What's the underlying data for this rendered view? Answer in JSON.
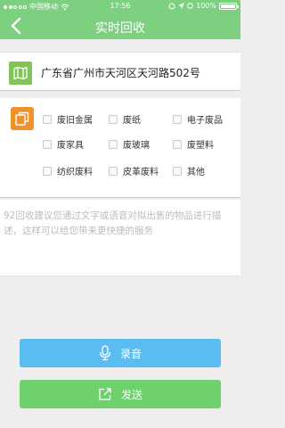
{
  "status_bar": {
    "carrier": "中国移动",
    "time": "17:56",
    "battery": "100%"
  },
  "nav": {
    "title": "实时回收"
  },
  "address": {
    "text": "广东省广州市天河区天河路502号"
  },
  "categories": [
    {
      "label": "废旧金属",
      "checked": false
    },
    {
      "label": "废纸",
      "checked": false
    },
    {
      "label": "电子废品",
      "checked": false
    },
    {
      "label": "废家具",
      "checked": false
    },
    {
      "label": "废玻璃",
      "checked": false
    },
    {
      "label": "废塑料",
      "checked": false
    },
    {
      "label": "纺织废料",
      "checked": false
    },
    {
      "label": "皮革废料",
      "checked": false
    },
    {
      "label": "其他",
      "checked": false
    }
  ],
  "description": {
    "placeholder": "92回收建议您通过文字或语音对拟出售的物品进行描述，这样可以给您带来更快捷的服务"
  },
  "buttons": {
    "record": "录音",
    "send": "发送"
  },
  "colors": {
    "header": "#7dd07f",
    "record_button": "#5bbcf2",
    "send_button": "#6fd06e",
    "address_icon": "#82c45a",
    "category_icon": "#f0922c"
  }
}
